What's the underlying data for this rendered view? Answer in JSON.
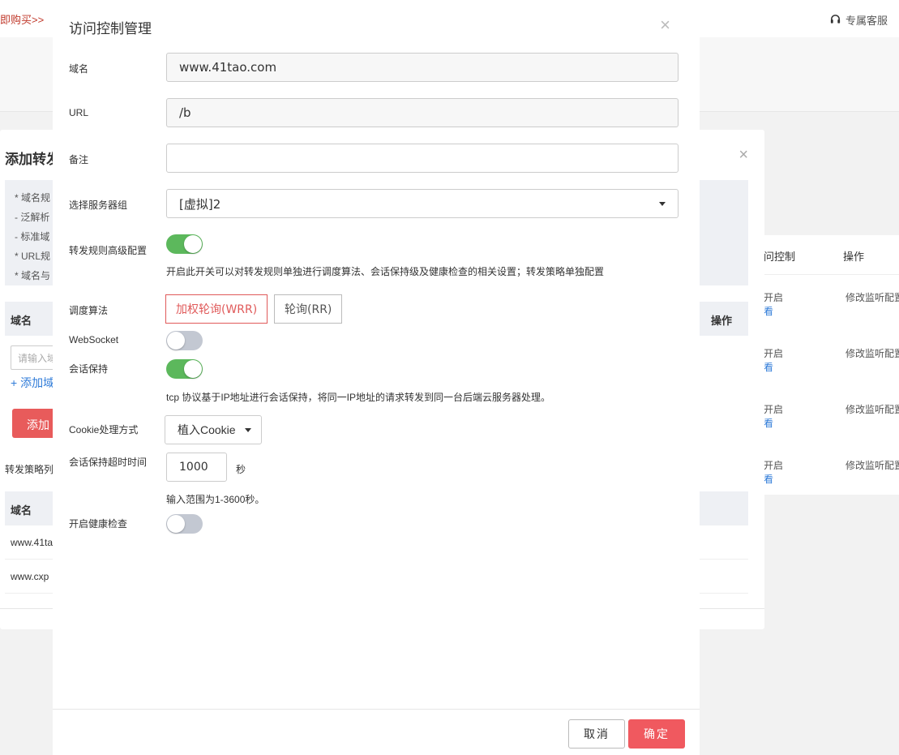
{
  "background": {
    "breadcrumb": "即购买>>",
    "service_label": "专属客服",
    "right_table": {
      "headers": [
        "问控制",
        "操作"
      ],
      "rows": [
        {
          "status": "开启",
          "link": "看",
          "action": "修改监听配置"
        },
        {
          "status": "开启",
          "link": "看",
          "action": "修改监听配置"
        },
        {
          "status": "开启",
          "link": "看",
          "action": "修改监听配置"
        },
        {
          "status": "开启",
          "link": "看",
          "action": "修改监听配置"
        }
      ]
    }
  },
  "second_dialog": {
    "title": "添加转发",
    "close": "×",
    "tips": [
      "* 域名规",
      "- 泛解析",
      "- 标准域",
      "* URL规",
      "* 域名与"
    ],
    "table_header": {
      "domain": "域名",
      "action": "操作"
    },
    "input_placeholder": "请输入域",
    "add_link": "+ 添加域",
    "add_button": "添加",
    "policy_label": "转发策略列",
    "policy_header": "域名",
    "policy_rows": [
      "www.41ta",
      "www.cxp"
    ]
  },
  "dialog": {
    "title": "访问控制管理",
    "close": "×",
    "domain_label": "域名",
    "domain_value": "www.41tao.com",
    "url_label": "URL",
    "url_value": "/b",
    "remark_label": "备注",
    "remark_value": "",
    "server_group_label": "选择服务器组",
    "server_group_value": "[虚拟]2",
    "advanced_label": "转发规则高级配置",
    "advanced_on": true,
    "advanced_hint": "开启此开关可以对转发规则单独进行调度算法、会话保持级及健康检查的相关设置；转发策略单独配置",
    "algo_label": "调度算法",
    "algo_options": [
      "加权轮询(WRR)",
      "轮询(RR)"
    ],
    "algo_selected": "加权轮询(WRR)",
    "websocket_label": "WebSocket",
    "websocket_on": false,
    "session_label": "会话保持",
    "session_on": true,
    "session_hint": "tcp 协议基于IP地址进行会话保持，将同一IP地址的请求转发到同一台后端云服务器处理。",
    "cookie_label": "Cookie处理方式",
    "cookie_value": "植入Cookie",
    "timeout_label": "会话保持超时时间",
    "timeout_value": "1000",
    "timeout_unit": "秒",
    "timeout_hint": "输入范围为1-3600秒。",
    "health_label": "开启健康检查",
    "health_on": false,
    "cancel_label": "取消",
    "ok_label": "确定"
  },
  "colors": {
    "accent": "#f0595f",
    "toggle_on": "#5cb85c",
    "toggle_off": "#c3c8d2",
    "link": "#2f7bd8"
  }
}
